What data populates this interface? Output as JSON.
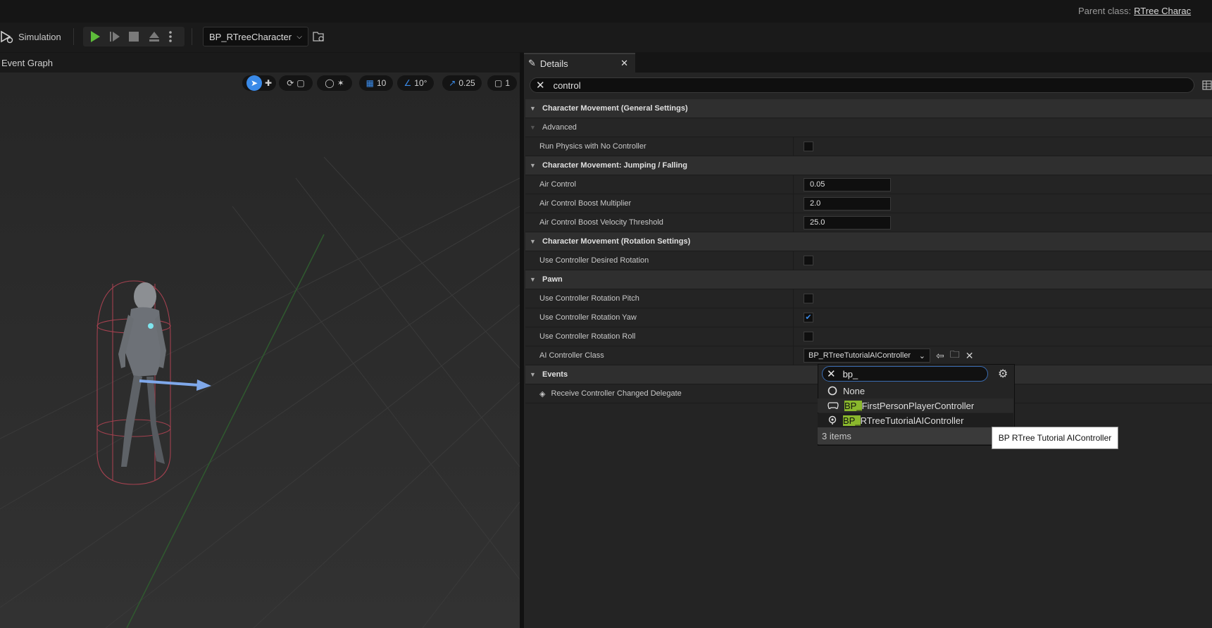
{
  "titlebar": {
    "parent_class_label": "Parent class:",
    "parent_class_value": "RTree Charac"
  },
  "toolbar": {
    "simulation_label": "Simulation",
    "blueprint_dropdown": "BP_RTreeCharacter"
  },
  "viewport": {
    "tab_label": "Event Graph",
    "grid_snap": "10",
    "rotation_snap": "10°",
    "scale_snap": "0.25",
    "camera_speed": "1"
  },
  "details": {
    "tab_label": "Details",
    "search_value": "control",
    "categories": {
      "general": "Character Movement (General Settings)",
      "advanced": "Advanced",
      "jumping": "Character Movement: Jumping / Falling",
      "rotation": "Character Movement (Rotation Settings)",
      "pawn": "Pawn",
      "events": "Events"
    },
    "props": {
      "run_physics": "Run Physics with No Controller",
      "air_control": "Air Control",
      "air_control_value": "0.05",
      "boost_multiplier": "Air Control Boost Multiplier",
      "boost_multiplier_value": "2.0",
      "boost_threshold": "Air Control Boost Velocity Threshold",
      "boost_threshold_value": "25.0",
      "desired_rotation": "Use Controller Desired Rotation",
      "rot_pitch": "Use Controller Rotation Pitch",
      "rot_yaw": "Use Controller Rotation Yaw",
      "rot_roll": "Use Controller Rotation Roll",
      "ai_controller_class": "AI Controller Class",
      "ai_controller_value": "BP_RTreeTutorialAIController",
      "receive_delegate": "Receive Controller Changed Delegate"
    },
    "checkboxes": {
      "run_physics": false,
      "desired_rotation": false,
      "rot_pitch": false,
      "rot_yaw": true,
      "rot_roll": false
    }
  },
  "popup": {
    "search_value": "bp_",
    "items": [
      {
        "label_hl": "",
        "label_rest": "None",
        "icon": "circle-icon"
      },
      {
        "label_hl": "BP_",
        "label_rest": "FirstPersonPlayerController",
        "icon": "gamepad-icon"
      },
      {
        "label_hl": "BP_",
        "label_rest": "RTreeTutorialAIController",
        "icon": "ai-brain-icon"
      }
    ],
    "count": "3 items",
    "tooltip": "BP RTree Tutorial AIController"
  },
  "colors": {
    "accent": "#3a8ae8",
    "highlight": "#8ab82d",
    "play": "#5dbb3a"
  }
}
